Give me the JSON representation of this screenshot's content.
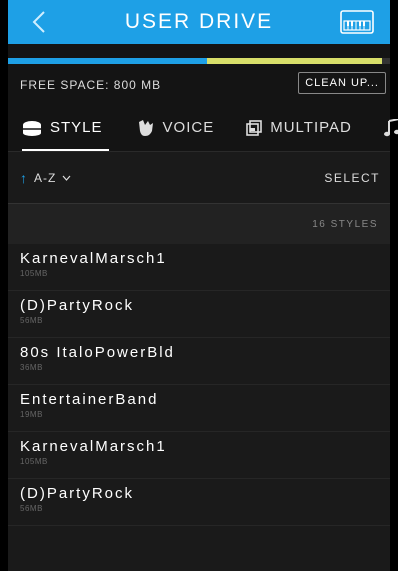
{
  "header": {
    "title": "USER DRIVE"
  },
  "storage": {
    "used_fraction": 0.52,
    "free_fraction": 0.46,
    "free_label": "FREE SPACE: 800 MB",
    "cleanup_label": "CLEAN UP..."
  },
  "tabs": [
    {
      "label": "STYLE",
      "icon": "style-icon",
      "active": true
    },
    {
      "label": "VOICE",
      "icon": "voice-icon",
      "active": false
    },
    {
      "label": "MULTIPAD",
      "icon": "multipad-icon",
      "active": false
    },
    {
      "label": "",
      "icon": "music-note-icon",
      "active": false
    }
  ],
  "sort": {
    "label": "A-Z",
    "select_label": "SELECT"
  },
  "list": {
    "count_label": "16 STYLES",
    "items": [
      {
        "name": "KarnevalMarsch1",
        "size": "105MB"
      },
      {
        "name": "(D)PartyRock",
        "size": "56MB"
      },
      {
        "name": "80s ItaloPowerBld",
        "size": "36MB"
      },
      {
        "name": "EntertainerBand",
        "size": "19MB"
      },
      {
        "name": "KarnevalMarsch1",
        "size": "105MB"
      },
      {
        "name": "(D)PartyRock",
        "size": "56MB"
      }
    ]
  },
  "colors": {
    "accent": "#1ea0e6",
    "free_bar": "#d8df6a",
    "background": "#1a1a1a"
  }
}
